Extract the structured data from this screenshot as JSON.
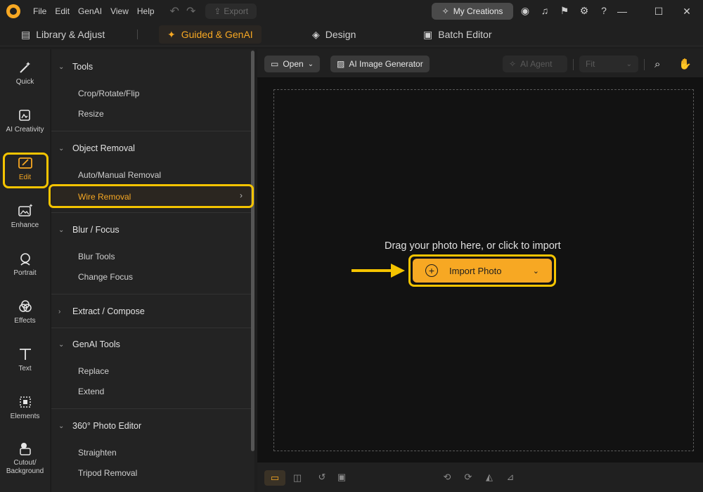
{
  "titlebar": {
    "menu": [
      "File",
      "Edit",
      "GenAI",
      "View",
      "Help"
    ],
    "export_label": "Export",
    "my_creations_label": "My Creations"
  },
  "tabs": [
    {
      "label": "Library & Adjust",
      "icon": "library-icon",
      "active": false
    },
    {
      "label": "Guided & GenAI",
      "icon": "magic-wand-icon",
      "active": true
    },
    {
      "label": "Design",
      "icon": "layers-icon",
      "active": false
    },
    {
      "label": "Batch Editor",
      "icon": "images-icon",
      "active": false
    }
  ],
  "rail": [
    {
      "label": "Quick",
      "icon": "magic-wand-icon"
    },
    {
      "label": "AI Creativity",
      "icon": "ai-creativity-icon"
    },
    {
      "label": "Edit",
      "icon": "edit-image-icon",
      "active": true
    },
    {
      "label": "Enhance",
      "icon": "enhance-icon"
    },
    {
      "label": "Portrait",
      "icon": "portrait-icon"
    },
    {
      "label": "Effects",
      "icon": "effects-icon"
    },
    {
      "label": "Text",
      "icon": "text-icon"
    },
    {
      "label": "Elements",
      "icon": "elements-icon"
    },
    {
      "label": "Cutout/ Background",
      "icon": "cutout-icon"
    }
  ],
  "panel": {
    "sections": [
      {
        "title": "Tools",
        "items": [
          "Crop/Rotate/Flip",
          "Resize"
        ]
      },
      {
        "title": "Object Removal",
        "items": [
          "Auto/Manual Removal",
          "Wire Removal"
        ]
      },
      {
        "title": "Blur / Focus",
        "items": [
          "Blur Tools",
          "Change Focus"
        ]
      },
      {
        "title": "Extract / Compose",
        "items": []
      },
      {
        "title": "GenAI Tools",
        "items": [
          "Replace",
          "Extend"
        ]
      },
      {
        "title": "360° Photo Editor",
        "items": [
          "Straighten",
          "Tripod Removal"
        ]
      }
    ],
    "selected_item": "Wire Removal"
  },
  "toolbar": {
    "open_label": "Open",
    "ai_image_generator_label": "AI Image Generator",
    "ai_agent_label": "AI Agent",
    "zoom_value": "Fit"
  },
  "canvas": {
    "prompt": "Drag your photo here, or click to import",
    "import_label": "Import Photo"
  },
  "colors": {
    "accent": "#f7a823",
    "highlight": "#f5c400"
  }
}
